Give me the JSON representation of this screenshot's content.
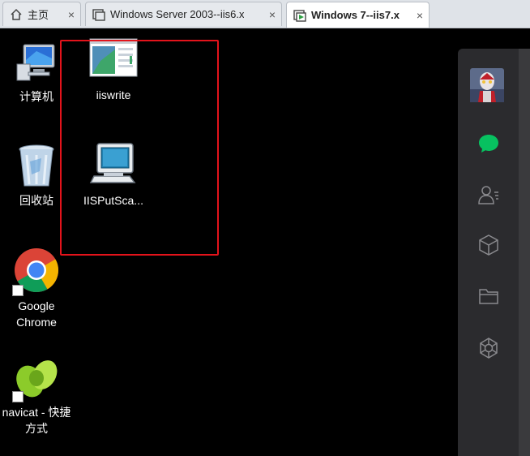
{
  "tabs": [
    {
      "label": "主页",
      "icon": "home-icon",
      "active": false
    },
    {
      "label": "Windows Server 2003--iis6.x",
      "icon": "vm-icon",
      "active": false
    },
    {
      "label": "Windows 7--iis7.x",
      "icon": "vm-running-icon",
      "active": true
    }
  ],
  "close_glyph": "×",
  "desktop": {
    "icons": [
      {
        "label": "计算机",
        "icon": "computer-icon"
      },
      {
        "label": "回收站",
        "icon": "recycle-bin-icon"
      },
      {
        "label": "Google Chrome",
        "icon": "chrome-icon",
        "shortcut": true
      },
      {
        "label": "navicat - 快捷方式",
        "icon": "navicat-icon",
        "shortcut": true
      },
      {
        "label": "iiswrite",
        "icon": "iiswrite-app-icon"
      },
      {
        "label": "IISPutSca...",
        "icon": "iisputscan-app-icon"
      }
    ]
  },
  "sidebar": {
    "items": [
      "avatar",
      "chat-icon",
      "contacts-icon",
      "box-icon",
      "folder-icon",
      "discover-icon"
    ],
    "active_color": "#07c160"
  }
}
